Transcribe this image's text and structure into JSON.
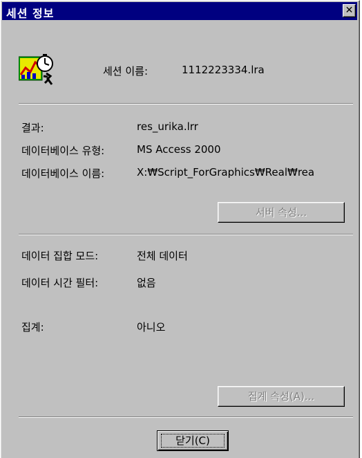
{
  "window": {
    "title": "세션 정보",
    "close_glyph": "✕"
  },
  "session": {
    "label": "세션 이름:",
    "value": "1112223334.lra"
  },
  "results": {
    "result_label": "결과:",
    "result_value": "res_urika.lrr",
    "db_type_label": "데이터베이스 유형:",
    "db_type_value": "MS Access 2000",
    "db_name_label": "데이터베이스 이름:",
    "db_name_value": "X:₩Script_ForGraphics₩Real₩rea"
  },
  "buttons": {
    "server_props": "서버 속성...",
    "summary_props": "집계 속성(A)...",
    "close": "닫기(C)"
  },
  "data_options": {
    "set_mode_label": "데이터 집합 모드:",
    "set_mode_value": "전체 데이터",
    "time_filter_label": "데이터 시간 필터:",
    "time_filter_value": "없음",
    "summary_label": "집계:",
    "summary_value": "아니오"
  },
  "icons": {
    "app_icon": "analysis-session-icon"
  }
}
